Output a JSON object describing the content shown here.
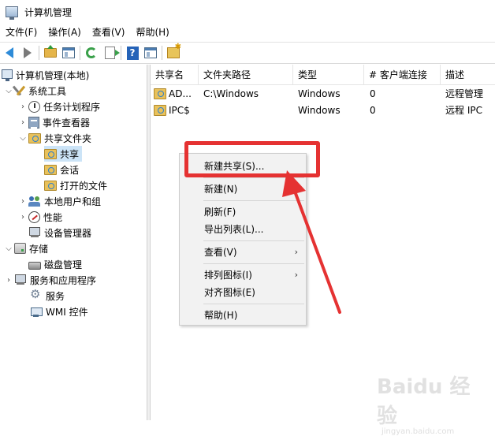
{
  "window": {
    "title": "计算机管理"
  },
  "menubar": [
    {
      "label": "文件(F)"
    },
    {
      "label": "操作(A)"
    },
    {
      "label": "查看(V)"
    },
    {
      "label": "帮助(H)"
    }
  ],
  "toolbar": {
    "buttons": [
      "back-icon",
      "forward-icon",
      "up-folder-icon",
      "show-hide-tree-icon",
      "refresh-icon",
      "export-list-icon",
      "help-icon",
      "properties-icon",
      "new-share-icon"
    ]
  },
  "tree": {
    "items": [
      {
        "label": "计算机管理(本地)"
      },
      {
        "label": "系统工具"
      },
      {
        "label": "任务计划程序"
      },
      {
        "label": "事件查看器"
      },
      {
        "label": "共享文件夹"
      },
      {
        "label": "共享"
      },
      {
        "label": "会话"
      },
      {
        "label": "打开的文件"
      },
      {
        "label": "本地用户和组"
      },
      {
        "label": "性能"
      },
      {
        "label": "设备管理器"
      },
      {
        "label": "存储"
      },
      {
        "label": "磁盘管理"
      },
      {
        "label": "服务和应用程序"
      },
      {
        "label": "服务"
      },
      {
        "label": "WMI 控件"
      }
    ],
    "selected": "共享"
  },
  "list": {
    "columns": [
      "共享名",
      "文件夹路径",
      "类型",
      "# 客户端连接",
      "描述"
    ],
    "rows": [
      {
        "name": "AD...",
        "path": "C:\\Windows",
        "type": "Windows",
        "clients": "0",
        "desc": "远程管理"
      },
      {
        "name": "IPC$",
        "path": "",
        "type": "Windows",
        "clients": "0",
        "desc": "远程 IPC"
      }
    ]
  },
  "context_menu": {
    "items": [
      {
        "label": "新建共享(S)..."
      },
      {
        "label": "新建(N)"
      },
      {
        "label": "刷新(F)"
      },
      {
        "label": "导出列表(L)..."
      },
      {
        "label": "查看(V)",
        "submenu_marker": "›"
      },
      {
        "label": "排列图标(I)",
        "submenu_marker": "›"
      },
      {
        "label": "对齐图标(E)"
      },
      {
        "label": "帮助(H)"
      }
    ]
  },
  "annotation": {
    "color": "#e53232"
  },
  "watermark": {
    "main": "Baidu 经验",
    "sub": "jingyan.baidu.com"
  }
}
